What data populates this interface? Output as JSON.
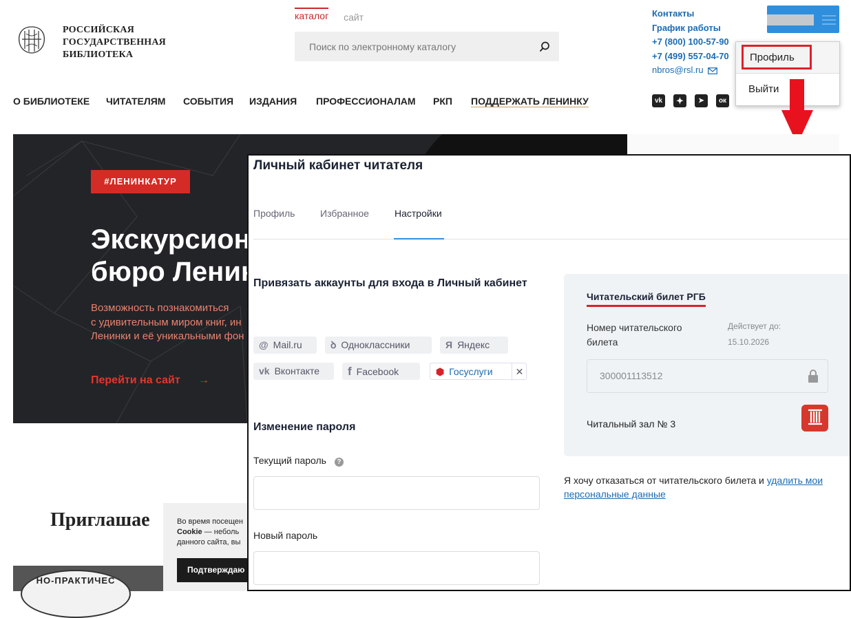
{
  "header": {
    "logo_line1": "РОССИЙСКАЯ",
    "logo_line2": "ГОСУДАРСТВЕННАЯ",
    "logo_line3": "БИБЛИОТЕКА",
    "search_tab_catalog": "каталог",
    "search_tab_site": "сайт",
    "search_placeholder": "Поиск по электронному каталогу",
    "contacts": "Контакты",
    "schedule": "График работы",
    "phone1": "+7 (800) 100-57-90",
    "phone2": "+7 (499) 557-04-70",
    "email": "nbros@rsl.ru"
  },
  "nav": {
    "items": [
      "О БИБЛИОТЕКЕ",
      "ЧИТАТЕЛЯМ",
      "СОБЫТИЯ",
      "ИЗДАНИЯ",
      "ПРОФЕССИОНАЛАМ",
      "РКП"
    ],
    "support": "ПОДДЕРЖАТЬ ЛЕНИНКУ"
  },
  "dropdown": {
    "profile": "Профиль",
    "exit": "Выйти"
  },
  "hero": {
    "tag": "#ЛЕНИНКАТУР",
    "title_line1": "Экскурсион",
    "title_line2": "бюро Ленин",
    "desc_line1": "Возможность познакомиться",
    "desc_line2": "с удивительным миром книг, ин",
    "desc_line3": "Ленинки и её уникальными фон",
    "link": "Перейти на сайт"
  },
  "invite": "Приглашае",
  "cookie": {
    "line1": "Во время посещен",
    "line2_bold": "Cookie",
    "line2_rest": " — неболь",
    "line3": "данного сайта, вы",
    "button": "Подтверждаю"
  },
  "stamp": "НО-ПРАКТИЧЕС",
  "cabinet": {
    "title": "Личный кабинет читателя",
    "tabs": [
      "Профиль",
      "Избранное",
      "Настройки"
    ],
    "active_tab": "Настройки",
    "bind_heading": "Привязать аккаунты для входа в Личный кабинет",
    "accounts": [
      {
        "icon": "@",
        "label": "Mail.ru"
      },
      {
        "icon": "ok",
        "label": "Одноклассники"
      },
      {
        "icon": "Я",
        "label": "Яндекс"
      },
      {
        "icon": "vk",
        "label": "Вконтакте"
      },
      {
        "icon": "f",
        "label": "Facebook"
      },
      {
        "icon": "gos",
        "label": "Госуслуги"
      }
    ],
    "password_heading": "Изменение пароля",
    "current_password": "Текущий пароль",
    "new_password": "Новый пароль",
    "card": {
      "title": "Читательский билет РГБ",
      "number_label": "Номер читательского билета",
      "valid_label": "Действует до:",
      "valid_value": "15.10.2026",
      "number": "300001113512",
      "hall": "Читальный зал № 3"
    },
    "refuse_text": "Я хочу отказаться от читательского билета и ",
    "refuse_link": "удалить мои персональные данные"
  },
  "colors": {
    "accent_red": "#d42b26",
    "link_blue": "#1a6bb3",
    "tab_active_line": "#2f8fdc",
    "annotation_red": "#e8121e"
  }
}
